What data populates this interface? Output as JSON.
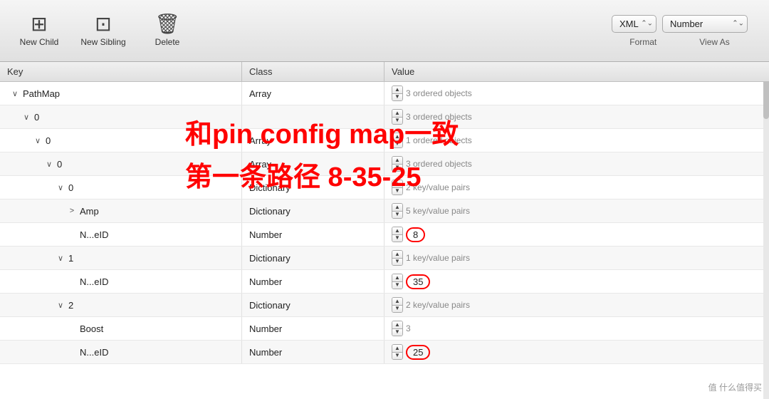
{
  "toolbar": {
    "new_child_label": "New Child",
    "new_sibling_label": "New Sibling",
    "delete_label": "Delete",
    "format_label": "Format",
    "viewas_label": "View As",
    "format_value": "XML",
    "viewas_value": "Number"
  },
  "table": {
    "headers": [
      "Key",
      "Class",
      "Value"
    ],
    "rows": [
      {
        "indent": 0,
        "disclosure": "∨",
        "key": "PathMap",
        "class": "Array",
        "value": "3 ordered objects",
        "highlighted": false
      },
      {
        "indent": 1,
        "disclosure": "∨",
        "key": "0",
        "class": "",
        "value": "3 ordered objects",
        "highlighted": false
      },
      {
        "indent": 2,
        "disclosure": "∨",
        "key": "0",
        "class": "Array",
        "value": "1 ordered objects",
        "highlighted": false
      },
      {
        "indent": 3,
        "disclosure": "∨",
        "key": "0",
        "class": "Array",
        "value": "3 ordered objects",
        "highlighted": false
      },
      {
        "indent": 4,
        "disclosure": "∨",
        "key": "0",
        "class": "Dictionary",
        "value": "2 key/value pairs",
        "highlighted": false
      },
      {
        "indent": 5,
        "disclosure": ">",
        "key": "Amp",
        "class": "Dictionary",
        "value": "5 key/value pairs",
        "highlighted": false
      },
      {
        "indent": 5,
        "disclosure": "",
        "key": "N...eID",
        "class": "Number",
        "value": "8",
        "highlighted": true
      },
      {
        "indent": 4,
        "disclosure": "∨",
        "key": "1",
        "class": "Dictionary",
        "value": "1 key/value pairs",
        "highlighted": false
      },
      {
        "indent": 5,
        "disclosure": "",
        "key": "N...eID",
        "class": "Number",
        "value": "35",
        "highlighted": true
      },
      {
        "indent": 4,
        "disclosure": "∨",
        "key": "2",
        "class": "Dictionary",
        "value": "2 key/value pairs",
        "highlighted": false
      },
      {
        "indent": 5,
        "disclosure": "",
        "key": "Boost",
        "class": "Number",
        "value": "3",
        "highlighted": false
      },
      {
        "indent": 5,
        "disclosure": "",
        "key": "N...eID",
        "class": "Number",
        "value": "25",
        "highlighted": true
      }
    ]
  },
  "annotation": {
    "line1": "和pin config map一致",
    "line2": "第一条路径 8-35-25"
  },
  "watermark": "值 什么值得买"
}
